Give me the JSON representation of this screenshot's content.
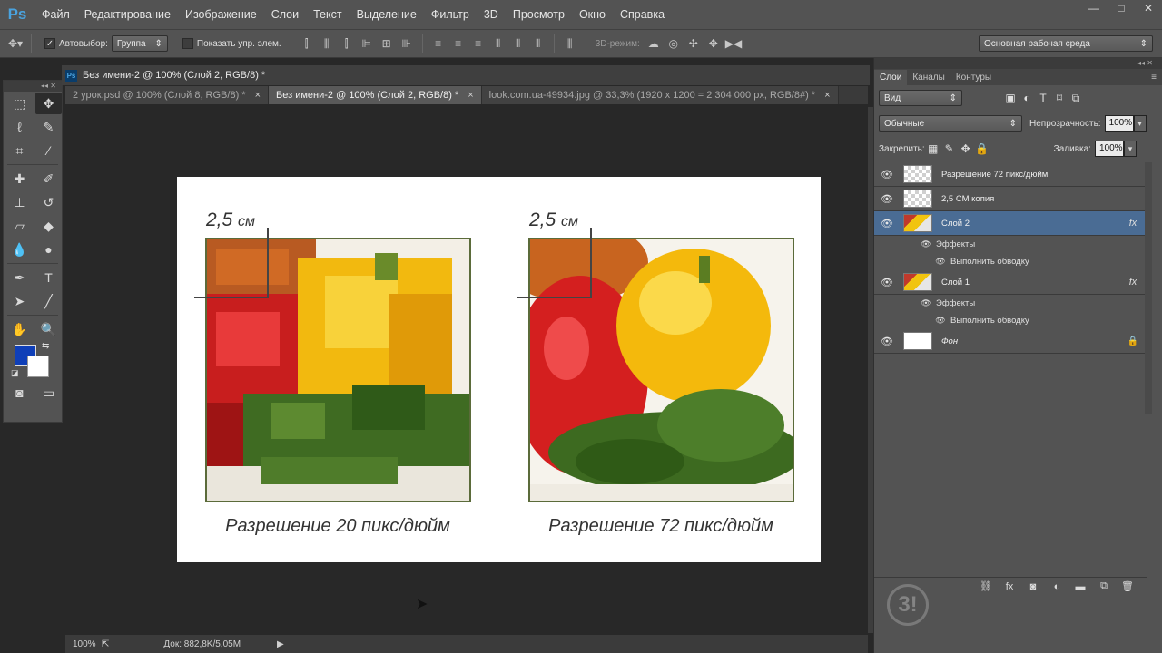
{
  "app": {
    "logo": "Ps",
    "menu": [
      "Файл",
      "Редактирование",
      "Изображение",
      "Слои",
      "Текст",
      "Выделение",
      "Фильтр",
      "3D",
      "Просмотр",
      "Окно",
      "Справка"
    ],
    "window_controls": [
      "—",
      "□",
      "✕"
    ]
  },
  "options_bar": {
    "autoselect_label": "Автовыбор:",
    "autoselect_checked": "✓",
    "autoselect_target": "Группа",
    "show_controls_label": "Показать упр. элем.",
    "mode_3d_label": "3D-режим:",
    "workspace": "Основная рабочая среда"
  },
  "document": {
    "title": "Без имени-2 @ 100% (Слой 2, RGB/8) *",
    "tabs": [
      {
        "label": "2 урок.psd @ 100% (Слой 8, RGB/8) *",
        "close": "×"
      },
      {
        "label": "Без имени-2 @ 100% (Слой 2, RGB/8) *",
        "close": "×"
      },
      {
        "label": "look.com.ua-49934.jpg @ 33,3% (1920 x 1200 = 2 304 000 px, RGB/8#) *",
        "close": "×"
      }
    ],
    "dimension_left": {
      "value": "2,5",
      "unit": "см"
    },
    "dimension_right": {
      "value": "2,5",
      "unit": "см"
    },
    "caption_left": "Разрешение 20 пикс/дюйм",
    "caption_right": "Разрешение 72 пикс/дюйм"
  },
  "status": {
    "zoom": "100%",
    "doc_size": "Док: 882,8K/5,05M"
  },
  "layers_panel": {
    "tabs": [
      "Слои",
      "Каналы",
      "Контуры"
    ],
    "filter_kind": "Вид",
    "blend_mode": "Обычные",
    "opacity_label": "Непрозрачность:",
    "opacity_value": "100%",
    "lock_label": "Закрепить:",
    "fill_label": "Заливка:",
    "fill_value": "100%",
    "layers": [
      {
        "name": "Разрешение 72 пикс/дюйм",
        "thumb": "checker"
      },
      {
        "name": "2,5 СМ копия",
        "thumb": "checker"
      },
      {
        "name": "Слой 2",
        "thumb": "img",
        "fx": "fx",
        "selected": true
      },
      {
        "name": "Слой 1",
        "thumb": "img",
        "fx": "fx"
      },
      {
        "name": "Фон",
        "thumb": "white",
        "locked": true
      }
    ],
    "effects_label": "Эффекты",
    "stroke_label": "Выполнить обводку"
  }
}
